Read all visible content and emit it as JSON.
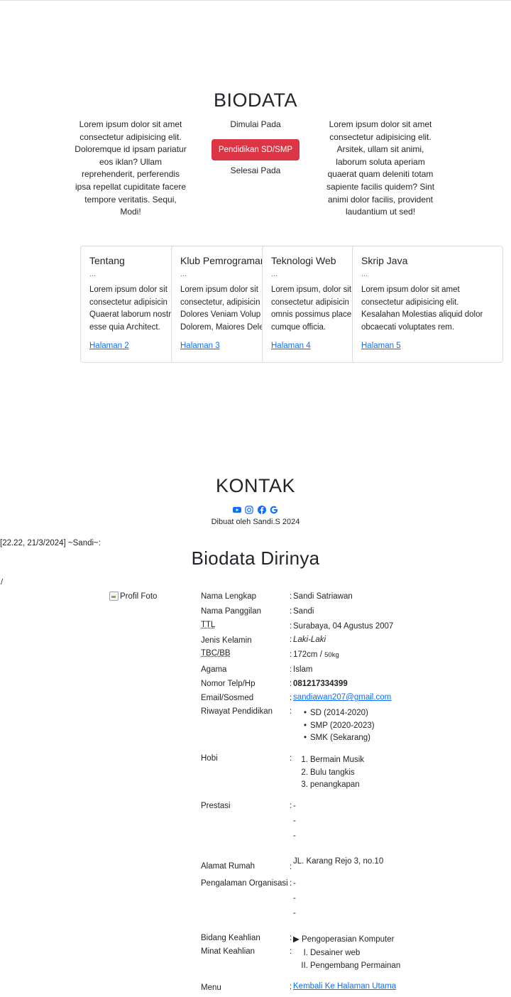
{
  "biodata": {
    "heading": "BIODATA",
    "left_paragraph": "Lorem ipsum dolor sit amet consectetur adipisicing elit. Doloremque id ipsam pariatur eos iklan? Ullam reprehenderit, perferendis ipsa repellat cupiditate facere tempore veritatis. Sequi, Modi!",
    "right_paragraph": "Lorem ipsum dolor sit amet consectetur adipisicing elit. Arsitek, ullam sit animi, laborum soluta aperiam quaerat quam deleniti totam sapiente facilis quidem? Sint animi dolor facilis, provident laudantium ut sed!",
    "start_label": "Dimulai Pada",
    "button_label": "Pendidikan SD/SMP",
    "end_label": "Selesai Pada"
  },
  "cards": [
    {
      "title": "Tentang",
      "sub": "...",
      "lines": [
        "Lorem ipsum dolor sit",
        "consectetur adipisicin",
        "Quaerat laborum nostr",
        "esse quia Architect."
      ],
      "link": "Halaman 2"
    },
    {
      "title": "Klub Pemrograman",
      "sub": "...",
      "lines": [
        "Lorem ipsum dolor sit",
        "consectetur, adipisicin",
        "Dolores Veniam Volup",
        "Dolorem, Maiores Dele"
      ],
      "link": "Halaman 3"
    },
    {
      "title": "Teknologi Web",
      "sub": "...",
      "lines": [
        "Lorem ipsum, dolor sit",
        "consectetur adipisicin",
        "omnis possimus place",
        "cumque officia."
      ],
      "link": "Halaman 4"
    },
    {
      "title": "Skrip Java",
      "sub": "...",
      "lines": [
        "Lorem ipsum dolor sit amet",
        "consectetur adipisicing elit.",
        "Kesalahan Molestias aliquid dolor",
        "obcaecati voluptates rem."
      ],
      "link": "Halaman 5"
    }
  ],
  "kontak": {
    "heading": "KONTAK",
    "credit": "Dibuat oleh Sandi.S 2024",
    "icons": [
      "youtube-icon",
      "instagram-icon",
      "facebook-icon",
      "google-icon"
    ],
    "colors": {
      "youtube": "#0d6efd",
      "instagram": "#0d6efd",
      "facebook": "#0d6efd",
      "google": "#0d6efd"
    }
  },
  "chat_line": "[22.22, 21/3/2024] ~Sandi~:",
  "profile": {
    "heading": "Biodata Dirinya",
    "slash": "/",
    "photo_alt": "Profil Foto",
    "colon": ":",
    "nama_lengkap": {
      "label": "Nama Lengkap",
      "value": "Sandi Satriawan"
    },
    "nama_panggilan": {
      "label": "Nama Panggilan",
      "value": "Sandi"
    },
    "ttl": {
      "label": "TTL",
      "value": "Surabaya, 04 Agustus 2007"
    },
    "jenis_kelamin": {
      "label": "Jenis Kelamin",
      "value": "Laki-Laki"
    },
    "tbc_bb": {
      "label": "TBC/BB",
      "height": "172cm /",
      "weight": "50kg"
    },
    "agama": {
      "label": "Agama",
      "value": "Islam"
    },
    "telp": {
      "label": "Nomor Telp/Hp",
      "value": "081217334399"
    },
    "email": {
      "label": "Email/Sosmed",
      "value": "sandiawan207@gmail.com"
    },
    "pendidikan": {
      "label": "Riwayat Pendidikan",
      "items": [
        "SD (2014-2020)",
        "SMP (2020-2023)",
        "SMK (Sekarang)"
      ]
    },
    "hobi": {
      "label": "Hobi",
      "items": [
        "Bermain Musik",
        "Bulu tangkis",
        "penangkapan"
      ],
      "markers": [
        "1.",
        "2.",
        "3."
      ]
    },
    "prestasi": {
      "label": "Prestasi",
      "values": [
        "-",
        "-",
        "-"
      ]
    },
    "alamat": {
      "label": "Alamat Rumah",
      "value": "JL. Karang Rejo 3, no.10"
    },
    "organisasi": {
      "label": "Pengalaman Organisasi",
      "values": [
        "-",
        "-",
        "-"
      ]
    },
    "bidang": {
      "label": "Bidang Keahlian",
      "value": "▶ Pengoperasian Komputer"
    },
    "minat": {
      "label": "Minat Keahlian",
      "items": [
        "Desainer web",
        "Pengembang Permainan"
      ],
      "markers": [
        "I.",
        "II."
      ]
    },
    "menu": {
      "label": "Menu",
      "value": "Kembali Ke Halaman Utama"
    }
  }
}
